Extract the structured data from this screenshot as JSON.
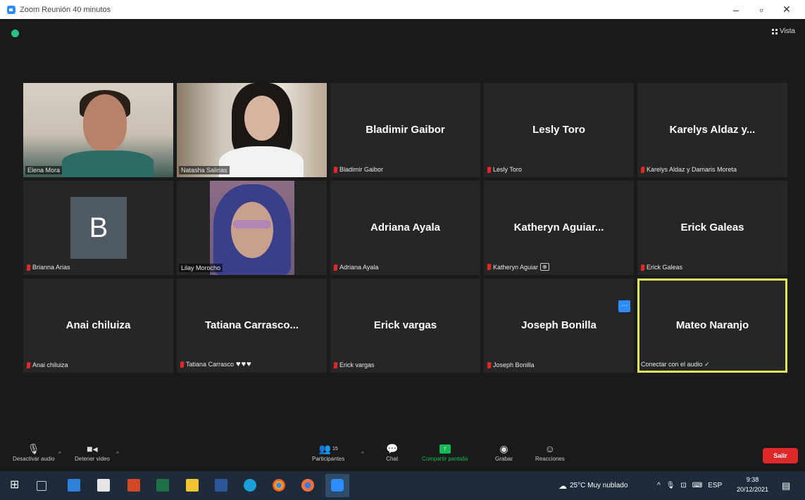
{
  "window": {
    "title": "Zoom Reunión 40 minutos",
    "minimize": "–",
    "maximize": "▫",
    "close": "✕"
  },
  "header": {
    "view_label": "Vista"
  },
  "tiles": [
    {
      "type": "video",
      "name": "Elena Mora",
      "video": "elena",
      "muted": false
    },
    {
      "type": "video",
      "name": "Natasha Salinas",
      "video": "nata",
      "muted": false
    },
    {
      "type": "name",
      "display": "Bladimir Gaibor",
      "name": "Bladimir Gaibor",
      "muted": true
    },
    {
      "type": "name",
      "display": "Lesly Toro",
      "name": "Lesly Toro",
      "muted": true
    },
    {
      "type": "name",
      "display": "Karelys Aldaz y...",
      "name": "Karelys Aldaz y Damaris Moreta",
      "muted": true
    },
    {
      "type": "avatar",
      "initial": "B",
      "name": "Brianna Arias",
      "muted": true
    },
    {
      "type": "video",
      "name": "Lilay Morocho",
      "video": "lilay",
      "muted": false
    },
    {
      "type": "name",
      "display": "Adriana Ayala",
      "name": "Adriana Ayala",
      "muted": true
    },
    {
      "type": "name",
      "display": "Katheryn  Aguiar...",
      "name": "Katheryn Aguiar",
      "muted": true,
      "host": "⊕"
    },
    {
      "type": "name",
      "display": "Erick Galeas",
      "name": "Erick Galeas",
      "muted": true
    },
    {
      "type": "name",
      "display": "Anai chiluiza",
      "name": "Anai chiluiza",
      "muted": true
    },
    {
      "type": "name",
      "display": "Tatiana  Carrasco...",
      "name": "Tatiana Carrasco",
      "muted": true,
      "hearts": "♥♥♥"
    },
    {
      "type": "name",
      "display": "Erick vargas",
      "name": "Erick vargas",
      "muted": true
    },
    {
      "type": "name",
      "display": "Joseph Bonilla",
      "name": "Joseph Bonilla",
      "muted": true
    },
    {
      "type": "name",
      "display": "Mateo Naranjo",
      "name": "Conectar con el audio ✓",
      "muted": false,
      "active": true
    }
  ],
  "toolbar": {
    "mute_label": "Desactivar audio",
    "video_label": "Detener video",
    "participants_label": "Participantes",
    "participants_count": "15",
    "chat_label": "Chat",
    "share_label": "Compartir pantalla",
    "record_label": "Grabar",
    "reactions_label": "Reacciones",
    "leave_label": "Salir"
  },
  "taskbar": {
    "weather": "25°C  Muy nublado",
    "language": "ESP",
    "time": "9:38",
    "date": "20/12/2021"
  },
  "colors": {
    "active_speaker": "#e3e85a",
    "share_green": "#16b853",
    "leave_red": "#e02828",
    "zoom_blue": "#2d8cff"
  }
}
